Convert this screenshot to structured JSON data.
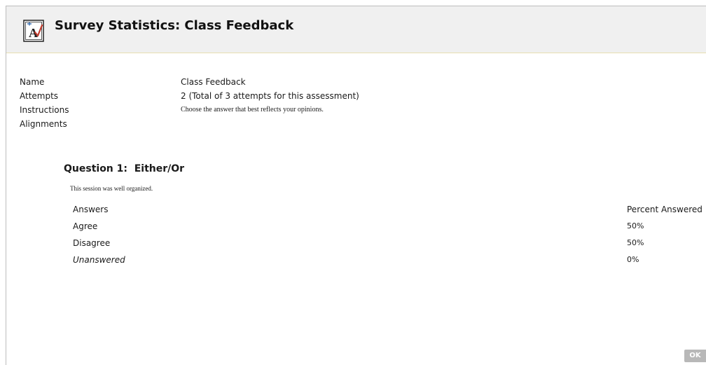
{
  "header": {
    "title": "Survey Statistics: Class Feedback",
    "icon": "survey-form-icon"
  },
  "details": [
    {
      "label": "Name",
      "value": "Class Feedback"
    },
    {
      "label": "Attempts",
      "value": "2 (Total of 3 attempts for this assessment)"
    },
    {
      "label": "Instructions",
      "value": "Choose the answer that best reflects your opinions."
    },
    {
      "label": "Alignments",
      "value": ""
    }
  ],
  "question": {
    "heading": "Question 1:  Either/Or",
    "text": "This session was well organized.",
    "columns": {
      "answer": "Answers",
      "percent": "Percent Answered"
    },
    "answers": [
      {
        "label": "Agree",
        "percent": "50%"
      },
      {
        "label": "Disagree",
        "percent": "50%"
      },
      {
        "label": "Unanswered",
        "percent": "0%"
      }
    ]
  },
  "footer": {
    "ok_label": "OK"
  },
  "colors": {
    "header_bg": "#f0f0f0",
    "header_border": "#e8dfb0",
    "ok_bg": "#b8b8b8"
  }
}
